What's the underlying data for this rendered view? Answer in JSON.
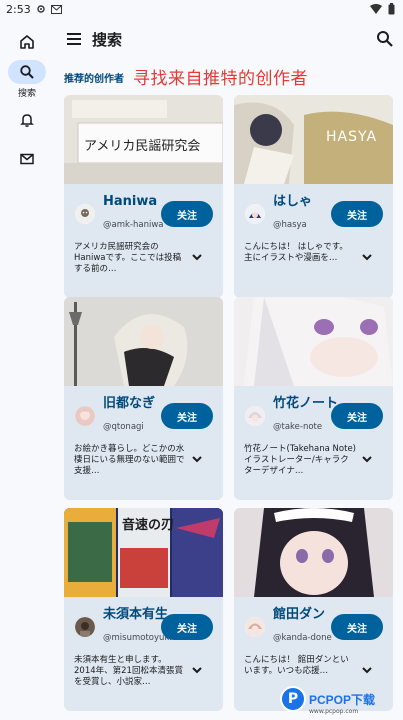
{
  "status": {
    "time": "2:53"
  },
  "rail": {
    "items": [
      {
        "icon": "home-icon",
        "label": ""
      },
      {
        "icon": "search-icon",
        "label": "搜索"
      },
      {
        "icon": "bell-icon",
        "label": ""
      },
      {
        "icon": "mail-icon",
        "label": ""
      }
    ]
  },
  "header": {
    "title": "搜索"
  },
  "section": {
    "label": "推荐的创作者",
    "caption": "寻找来自推特的创作者"
  },
  "colors": {
    "accent": "#00629d",
    "name": "#00497d",
    "caption": "#e53935",
    "card": "#dfe7f0"
  },
  "cards": [
    {
      "name": "Haniwa",
      "handle": "@amk-haniwa",
      "bio": "アメリカ民謡研究会の Haniwaです。ここでは投稿する前の…",
      "follow": "关注",
      "banner_text": "アメリカ民謡研究会"
    },
    {
      "name": "はしゃ",
      "handle": "@hasya",
      "bio": "こんにちは！ はしゃです。主にイラストや漫画を…",
      "follow": "关注",
      "banner_text": "HASYA"
    },
    {
      "name": "旧都なぎ",
      "handle": "@qtonagi",
      "bio": "お絵かき暮らし。どこかの水棲日にいる無理のない範囲で支援…",
      "follow": "关注",
      "banner_text": ""
    },
    {
      "name": "竹花ノート",
      "handle": "@take-note",
      "bio": "竹花ノート(Takehana Note)イラストレーター/キャラクターデザイナ…",
      "follow": "关注",
      "banner_text": ""
    },
    {
      "name": "未須本有生",
      "handle": "@misumotoyuki",
      "bio": "未須本有生と申します。2014年、第21回松本清張賞を受賞し、小説家…",
      "follow": "关注",
      "banner_text": "音速の刃"
    },
    {
      "name": "館田ダン",
      "handle": "@kanda-done",
      "bio": "こんにちは！ 館田ダンといいます。いつも応援…",
      "follow": "关注",
      "banner_text": ""
    }
  ],
  "watermark": {
    "logo": "P",
    "text": "PCPOP下载",
    "sub": "www.pcpop.com"
  }
}
